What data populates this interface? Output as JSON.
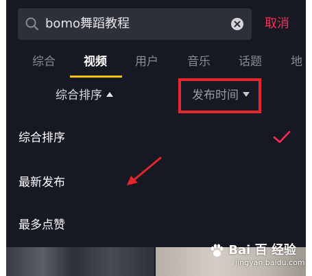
{
  "search": {
    "query": "bomo舞蹈教程",
    "cancel_label": "取消"
  },
  "tabs": [
    {
      "label": "综合",
      "active": false
    },
    {
      "label": "视频",
      "active": true
    },
    {
      "label": "用户",
      "active": false
    },
    {
      "label": "音乐",
      "active": false
    },
    {
      "label": "话题",
      "active": false
    },
    {
      "label": "地",
      "active": false
    }
  ],
  "sort": {
    "primary_label": "综合排序",
    "time_label": "发布时间"
  },
  "dropdown": {
    "options": [
      {
        "label": "综合排序",
        "selected": true
      },
      {
        "label": "最新发布",
        "selected": false
      },
      {
        "label": "最多点赞",
        "selected": false
      }
    ]
  },
  "watermark": {
    "logo_text": "Bai 百 经验",
    "url": "jingyan.baidu.com"
  },
  "colors": {
    "background": "#161823",
    "accent": "#fe2c55",
    "tab_underline": "#f5c400",
    "annotation_red": "#e5262b"
  },
  "icons": [
    "search-icon",
    "clear-icon",
    "triangle-up-icon",
    "triangle-down-icon",
    "check-icon",
    "arrow-annotation-icon",
    "paw-icon"
  ]
}
